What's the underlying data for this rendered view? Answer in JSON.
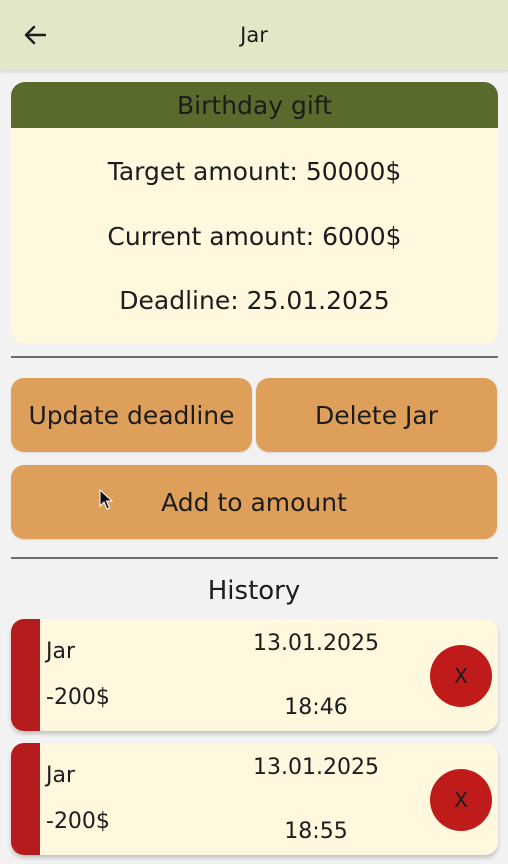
{
  "header": {
    "back_icon": "arrow-left-icon",
    "title": "Jar"
  },
  "jar": {
    "name": "Birthday gift",
    "target": "Target amount: 50000$",
    "current": "Current amount: 6000$",
    "deadline": "Deadline: 25.01.2025"
  },
  "actions": {
    "update_deadline": "Update deadline",
    "delete_jar": "Delete Jar",
    "add_amount": "Add to amount"
  },
  "history": {
    "title": "History",
    "items": [
      {
        "name": "Jar",
        "amount": "-200$",
        "date": "13.01.2025",
        "time": "18:46",
        "delete_label": "X"
      },
      {
        "name": "Jar",
        "amount": "-200$",
        "date": "13.01.2025",
        "time": "18:55",
        "delete_label": "X"
      }
    ]
  },
  "colors": {
    "header_bg": "#e3e6c7",
    "card_header": "#596a2d",
    "card_bg": "#fff8df",
    "button": "#dd9f5a",
    "danger": "#b71c1c"
  }
}
